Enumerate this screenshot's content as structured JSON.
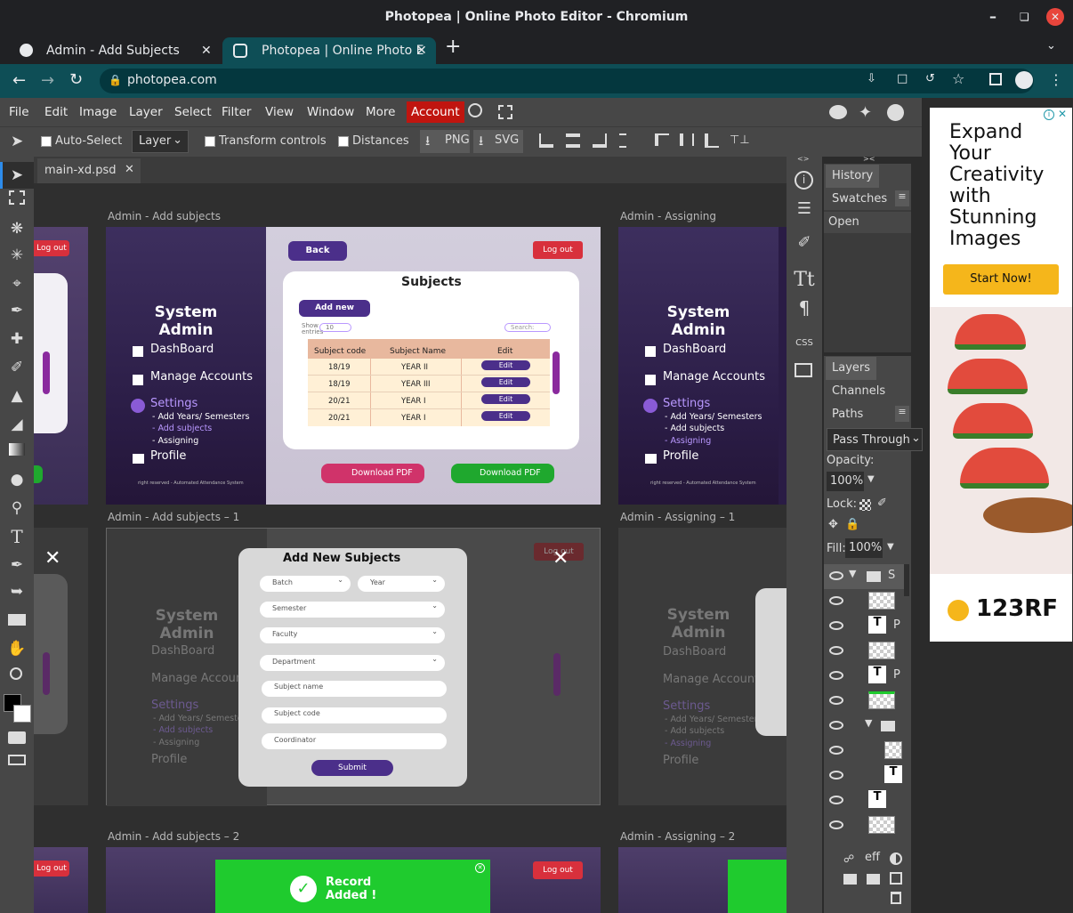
{
  "window": {
    "title": "Photopea | Online Photo Editor - Chromium"
  },
  "browser": {
    "tabs": [
      {
        "label": "Admin - Add Subjects"
      },
      {
        "label": "Photopea | Online Photo E"
      }
    ],
    "url": "photopea.com"
  },
  "menu": {
    "items": [
      "File",
      "Edit",
      "Image",
      "Layer",
      "Select",
      "Filter",
      "View",
      "Window",
      "More",
      "Account"
    ]
  },
  "options": {
    "auto_select": "Auto-Select",
    "layer_select": "Layer",
    "transform_controls": "Transform controls",
    "distances": "Distances",
    "png": "PNG",
    "svg": "SVG"
  },
  "document": {
    "tab": "main-xd.psd"
  },
  "canvas": {
    "artboards": {
      "a1": "Admin - Add subjects",
      "a2": "Admin - Assigning",
      "a3": "Admin - Add subjects – 1",
      "a4": "Admin - Assigning – 1",
      "a5": "Admin - Add subjects – 2",
      "a6": "Admin - Assigning – 2"
    },
    "sidebar": {
      "title1": "System",
      "title2": "Admin",
      "dashboard": "DashBoard",
      "manage": "Manage Accounts",
      "settings": "Settings",
      "years": "- Add Years/ Semesters",
      "subjects": "- Add subjects",
      "assigning": "- Assigning",
      "profile": "Profile",
      "footer": "right reserved - Automated Attendance System",
      "logout": "Log out"
    },
    "subjects": {
      "back": "Back",
      "title": "Subjects",
      "add_new": "Add new",
      "show": "Show",
      "entries": "entries",
      "show_val": "10",
      "search": "Search:",
      "headers": [
        "Subject code",
        "Subject Name",
        "Edit"
      ],
      "rows": [
        [
          "18/19",
          "YEAR II",
          "Edit"
        ],
        [
          "18/19",
          "YEAR III",
          "Edit"
        ],
        [
          "20/21",
          "YEAR I",
          "Edit"
        ],
        [
          "20/21",
          "YEAR I",
          "Edit"
        ]
      ],
      "pdf1": "Download PDF",
      "pdf2": "Download PDF"
    },
    "modal": {
      "title": "Add New Subjects",
      "batch": "Batch",
      "year": "Year",
      "semester": "Semester",
      "faculty": "Faculty",
      "department": "Department",
      "subject_name": "Subject name",
      "subject_code": "Subject code",
      "coordinator": "Coordinator",
      "submit": "Submit"
    },
    "toast": {
      "line1": "Record",
      "line2": "Added !"
    }
  },
  "panels": {
    "history": "History",
    "swatches": "Swatches",
    "history_item": "Open",
    "layers": "Layers",
    "channels": "Channels",
    "paths": "Paths",
    "blend": "Pass Through",
    "opacity_label": "Opacity:",
    "opacity": "100%",
    "lock": "Lock:",
    "fill_label": "Fill:",
    "fill": "100%",
    "rows": [
      {
        "thumb": "folder",
        "label": "S"
      },
      {
        "thumb": "img",
        "label": ""
      },
      {
        "thumb": "T",
        "label": "P"
      },
      {
        "thumb": "img",
        "label": ""
      },
      {
        "thumb": "T",
        "label": "P"
      },
      {
        "thumb": "img",
        "label": ""
      },
      {
        "thumb": "folder",
        "label": ""
      },
      {
        "thumb": "img",
        "label": ""
      },
      {
        "thumb": "T",
        "label": ""
      },
      {
        "thumb": "T",
        "label": ""
      },
      {
        "thumb": "img",
        "label": ""
      }
    ],
    "eff": "eff"
  },
  "ad": {
    "headline": "Expand Your Creativity with Stunning Images",
    "cta": "Start Now!",
    "brand": "123RF"
  },
  "colors": {
    "accent_red": "#c0150f",
    "purple": "#4b2f8a",
    "green": "#1fcb2e",
    "ad_cta": "#f5b61b"
  }
}
